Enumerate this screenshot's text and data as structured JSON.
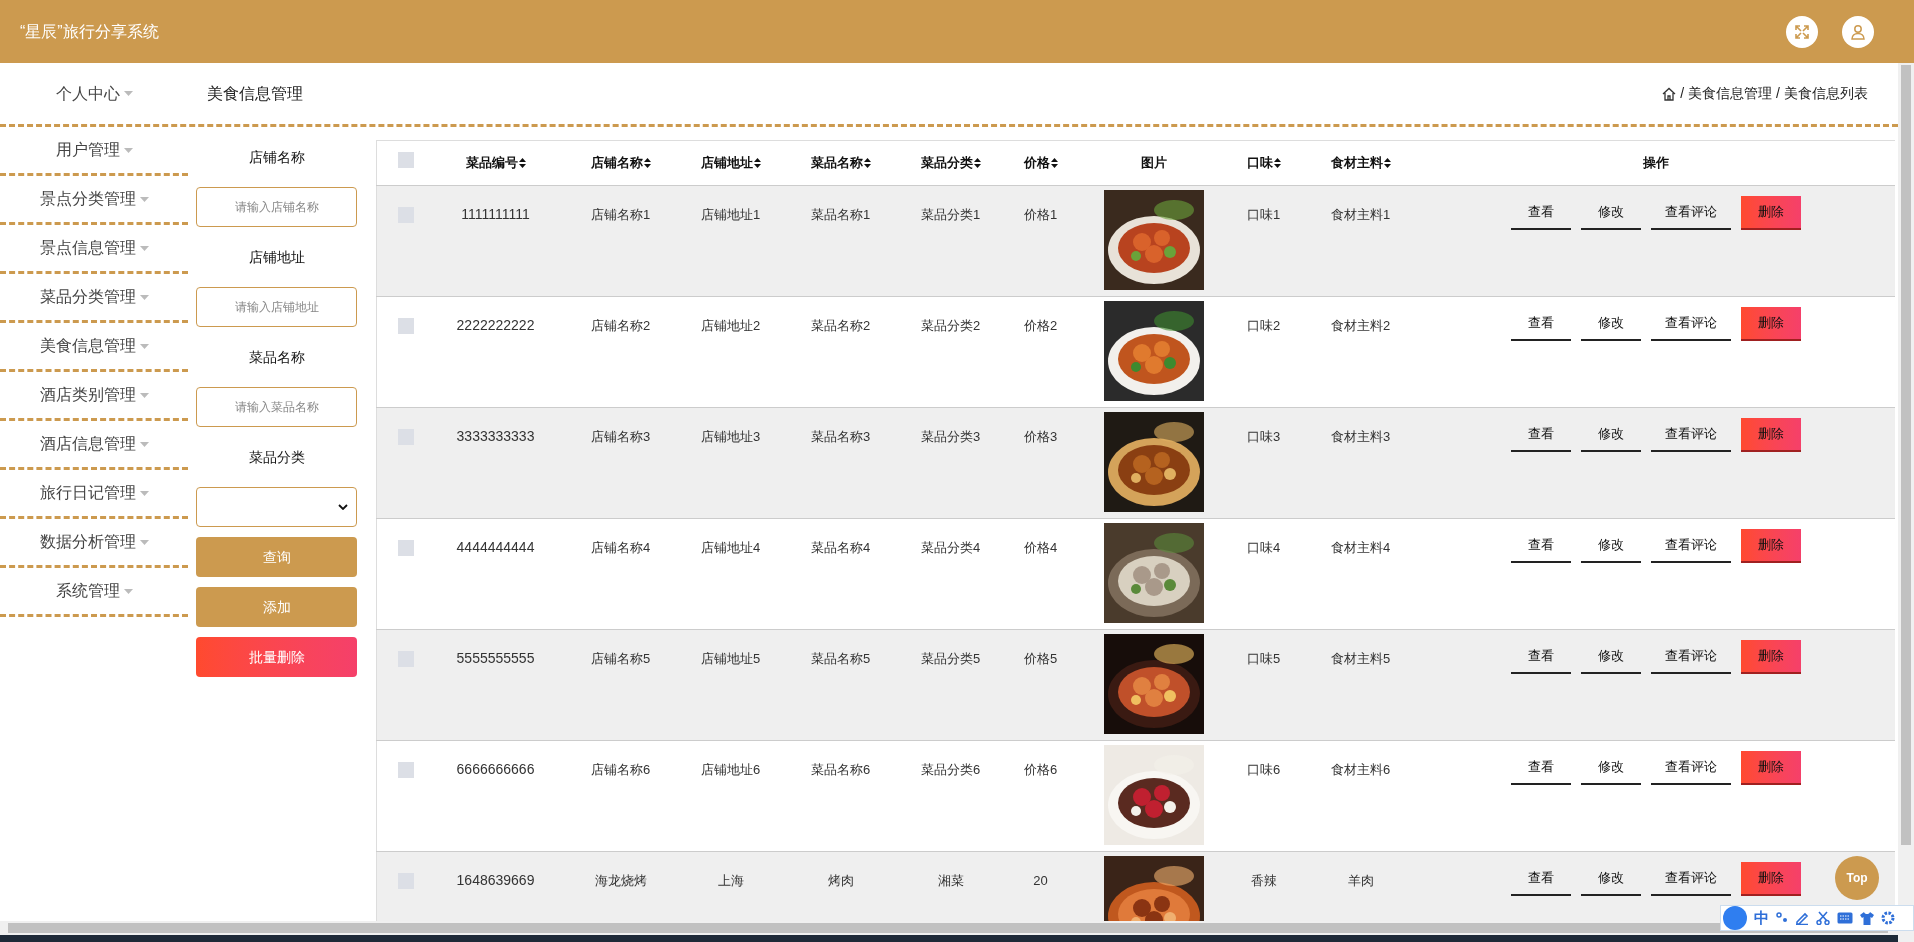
{
  "header": {
    "title": "“星辰”旅行分享系统"
  },
  "sidebar": {
    "items": [
      {
        "label": "个人中心"
      },
      {
        "label": "用户管理"
      },
      {
        "label": "景点分类管理"
      },
      {
        "label": "景点信息管理"
      },
      {
        "label": "菜品分类管理"
      },
      {
        "label": "美食信息管理"
      },
      {
        "label": "酒店类别管理"
      },
      {
        "label": "酒店信息管理"
      },
      {
        "label": "旅行日记管理"
      },
      {
        "label": "数据分析管理"
      },
      {
        "label": "系统管理"
      }
    ]
  },
  "page_title": "美食信息管理",
  "breadcrumb": {
    "separator": "/",
    "path": [
      "美食信息管理",
      "美食信息列表"
    ]
  },
  "filters": {
    "fields": [
      {
        "kind": "text",
        "label": "店铺名称",
        "placeholder": "请输入店铺名称"
      },
      {
        "kind": "text",
        "label": "店铺地址",
        "placeholder": "请输入店铺地址"
      },
      {
        "kind": "text",
        "label": "菜品名称",
        "placeholder": "请输入菜品名称"
      },
      {
        "kind": "select",
        "label": "菜品分类"
      }
    ],
    "buttons": [
      {
        "kind": "primary",
        "label": "查询"
      },
      {
        "kind": "primary",
        "label": "添加"
      },
      {
        "kind": "danger",
        "label": "批量删除"
      }
    ]
  },
  "table": {
    "header_checked": false,
    "columns": [
      {
        "label": "菜品编号",
        "sortable": true
      },
      {
        "label": "店铺名称",
        "sortable": true
      },
      {
        "label": "店铺地址",
        "sortable": true
      },
      {
        "label": "菜品名称",
        "sortable": true
      },
      {
        "label": "菜品分类",
        "sortable": true
      },
      {
        "label": "价格",
        "sortable": true
      },
      {
        "label": "图片",
        "sortable": false
      },
      {
        "label": "口味",
        "sortable": true
      },
      {
        "label": "食材主料",
        "sortable": true
      },
      {
        "label": "操作",
        "sortable": false
      }
    ],
    "rows": [
      {
        "checked": false,
        "cells": [
          "1111111111",
          "店铺名称1",
          "店铺地址1",
          "菜品名称1",
          "菜品分类1",
          "价格1",
          {
            "kind": "picture"
          },
          "口味1",
          "食材主料1"
        ],
        "actions": [
          {
            "kind": "plain",
            "label": "查看"
          },
          {
            "kind": "plain",
            "label": "修改"
          },
          {
            "kind": "plain",
            "label": "查看评论"
          },
          {
            "kind": "danger",
            "label": "删除"
          }
        ]
      },
      {
        "checked": false,
        "cells": [
          "2222222222",
          "店铺名称2",
          "店铺地址2",
          "菜品名称2",
          "菜品分类2",
          "价格2",
          {
            "kind": "picture"
          },
          "口味2",
          "食材主料2"
        ],
        "actions": [
          {
            "kind": "plain",
            "label": "查看"
          },
          {
            "kind": "plain",
            "label": "修改"
          },
          {
            "kind": "plain",
            "label": "查看评论"
          },
          {
            "kind": "danger",
            "label": "删除"
          }
        ]
      },
      {
        "checked": false,
        "cells": [
          "3333333333",
          "店铺名称3",
          "店铺地址3",
          "菜品名称3",
          "菜品分类3",
          "价格3",
          {
            "kind": "picture"
          },
          "口味3",
          "食材主料3"
        ],
        "actions": [
          {
            "kind": "plain",
            "label": "查看"
          },
          {
            "kind": "plain",
            "label": "修改"
          },
          {
            "kind": "plain",
            "label": "查看评论"
          },
          {
            "kind": "danger",
            "label": "删除"
          }
        ]
      },
      {
        "checked": false,
        "cells": [
          "4444444444",
          "店铺名称4",
          "店铺地址4",
          "菜品名称4",
          "菜品分类4",
          "价格4",
          {
            "kind": "picture"
          },
          "口味4",
          "食材主料4"
        ],
        "actions": [
          {
            "kind": "plain",
            "label": "查看"
          },
          {
            "kind": "plain",
            "label": "修改"
          },
          {
            "kind": "plain",
            "label": "查看评论"
          },
          {
            "kind": "danger",
            "label": "删除"
          }
        ]
      },
      {
        "checked": false,
        "cells": [
          "5555555555",
          "店铺名称5",
          "店铺地址5",
          "菜品名称5",
          "菜品分类5",
          "价格5",
          {
            "kind": "picture"
          },
          "口味5",
          "食材主料5"
        ],
        "actions": [
          {
            "kind": "plain",
            "label": "查看"
          },
          {
            "kind": "plain",
            "label": "修改"
          },
          {
            "kind": "plain",
            "label": "查看评论"
          },
          {
            "kind": "danger",
            "label": "删除"
          }
        ]
      },
      {
        "checked": false,
        "cells": [
          "6666666666",
          "店铺名称6",
          "店铺地址6",
          "菜品名称6",
          "菜品分类6",
          "价格6",
          {
            "kind": "picture"
          },
          "口味6",
          "食材主料6"
        ],
        "actions": [
          {
            "kind": "plain",
            "label": "查看"
          },
          {
            "kind": "plain",
            "label": "修改"
          },
          {
            "kind": "plain",
            "label": "查看评论"
          },
          {
            "kind": "danger",
            "label": "删除"
          }
        ]
      },
      {
        "checked": false,
        "cells": [
          "1648639669",
          "海龙烧烤",
          "上海",
          "烤肉",
          "湘菜",
          "20",
          {
            "kind": "picture"
          },
          "香辣",
          "羊肉"
        ],
        "actions": [
          {
            "kind": "plain",
            "label": "查看"
          },
          {
            "kind": "plain",
            "label": "修改"
          },
          {
            "kind": "plain",
            "label": "查看评论"
          },
          {
            "kind": "danger",
            "label": "删除"
          }
        ]
      }
    ]
  },
  "back_to_top": "Top",
  "ime_bar": {
    "mode": "中"
  }
}
